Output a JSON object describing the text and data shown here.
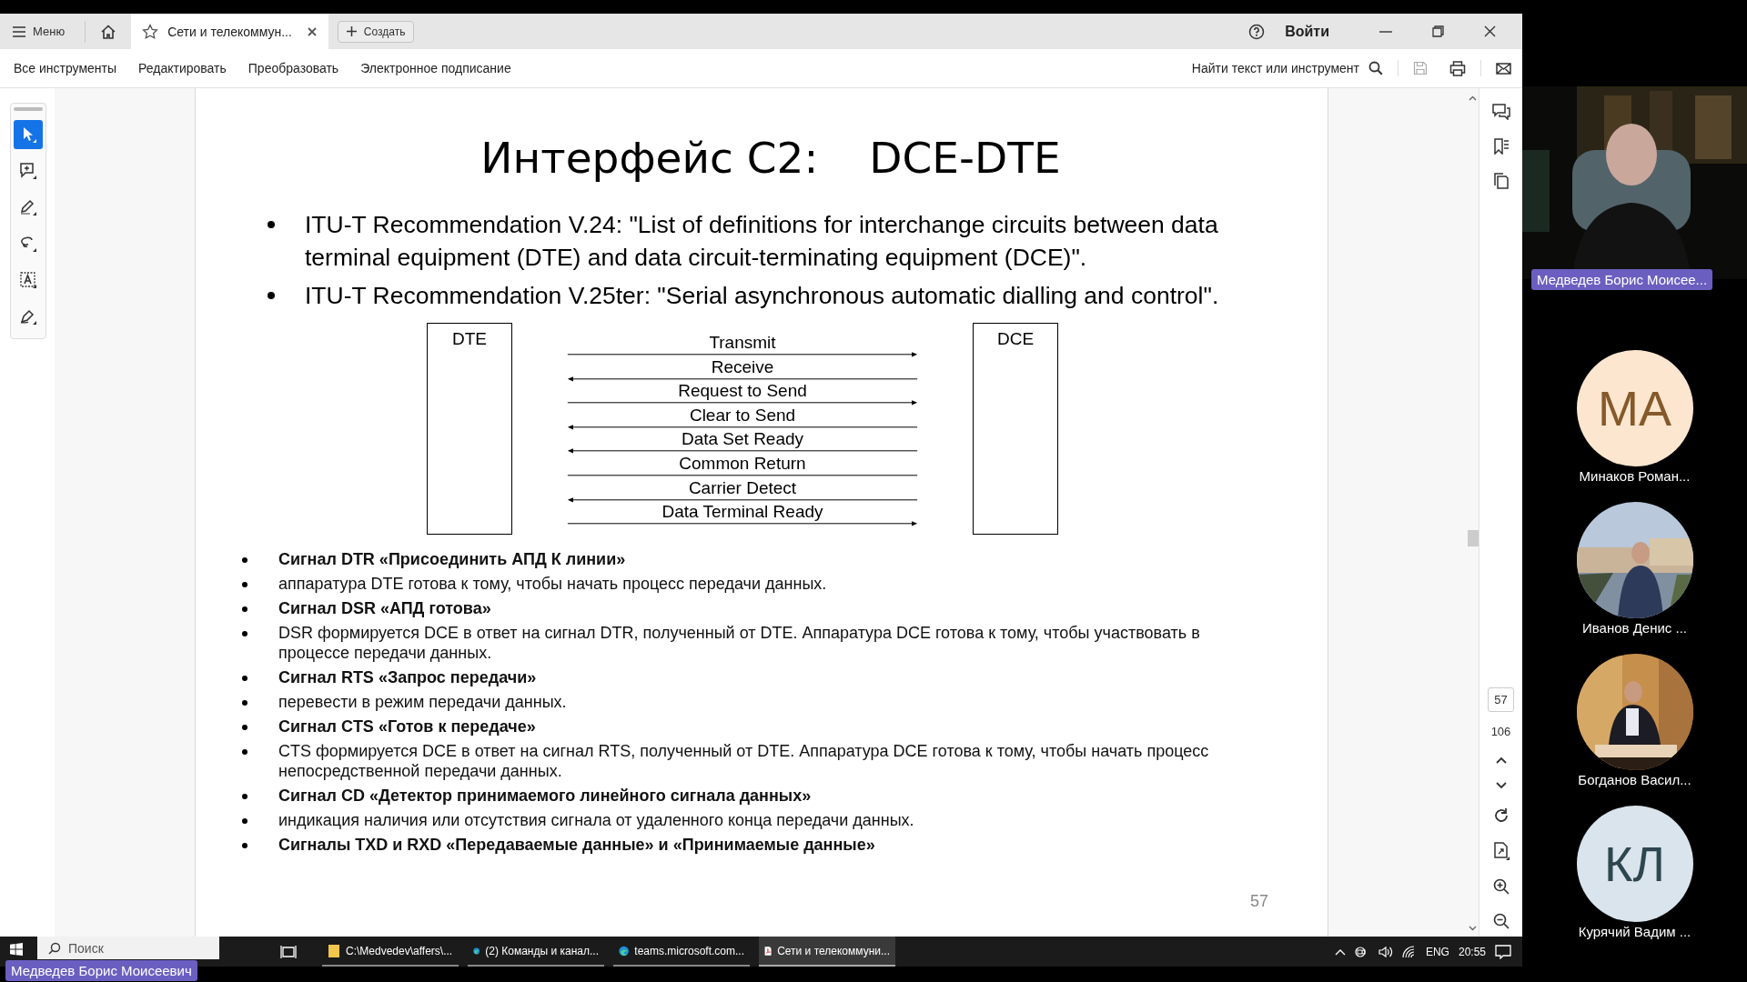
{
  "app_bar": {
    "menu": "Меню",
    "tabs": [
      {
        "title": "Сети и телекоммун...",
        "selected": true
      }
    ],
    "create": "Создать",
    "sign_in": "Войти"
  },
  "toolbar": {
    "items": [
      "Все инструменты",
      "Редактировать",
      "Преобразовать",
      "Электронное подписание"
    ],
    "search": "Найти текст или инструмент"
  },
  "tools": [
    {
      "kind": "select",
      "selected": true
    },
    {
      "kind": "comment",
      "selected": false
    },
    {
      "kind": "draw",
      "selected": false
    },
    {
      "kind": "lasso",
      "selected": false
    },
    {
      "kind": "text",
      "selected": false
    },
    {
      "kind": "sign",
      "selected": false
    }
  ],
  "slide": {
    "title": [
      "Интерфейс C2:",
      "DCE-DTE"
    ],
    "bullets": [
      "ITU-T Recommendation V.24: \"List of definitions for interchange circuits between data terminal equipment (DTE) and data circuit-terminating equipment (DCE)\".",
      "ITU-T Recommendation V.25ter: \"Serial asynchronous automatic dialling and control\"."
    ],
    "diagram": {
      "left": "DTE",
      "right": "DCE",
      "signals": [
        {
          "label": "Transmit",
          "kind": "right"
        },
        {
          "label": "Receive",
          "kind": "left"
        },
        {
          "label": "Request to Send",
          "kind": "right"
        },
        {
          "label": "Clear to Send",
          "kind": "left"
        },
        {
          "label": "Data Set Ready",
          "kind": "left"
        },
        {
          "label": "Common Return",
          "kind": "line"
        },
        {
          "label": "Carrier Detect",
          "kind": "left"
        },
        {
          "label": "Data Terminal Ready",
          "kind": "right"
        }
      ]
    },
    "notes": [
      {
        "kind": "heading",
        "text": "Сигнал DTR «Присоединить АПД К линии»"
      },
      {
        "kind": "text",
        "text": "аппаратура DTE готова к тому, чтобы начать процесс передачи данных."
      },
      {
        "kind": "heading",
        "text": "Сигнал DSR «АПД готова»"
      },
      {
        "kind": "text",
        "text": "DSR формируется DCE в ответ на сигнал DTR, полученный от DTE. Аппаратура DCE готова к тому, чтобы участвовать в процессе передачи данных."
      },
      {
        "kind": "heading",
        "text": "Сигнал RTS «Запрос передачи»"
      },
      {
        "kind": "text",
        "text": "перевести в режим передачи данных."
      },
      {
        "kind": "heading",
        "text": "Сигнал CTS «Готов к передаче»"
      },
      {
        "kind": "text",
        "text": "CTS формируется DCE в ответ на сигнал RTS, полученный от DTE. Аппаратура DCE готова к тому, чтобы начать процесс непосредственной передачи данных."
      },
      {
        "kind": "heading",
        "text": "Сигнал CD «Детектор принимаемого линейного сигнала данных»"
      },
      {
        "kind": "text",
        "text": "индикация наличия или отсутствия сигнала от удаленного конца передачи данных."
      },
      {
        "kind": "heading",
        "text": "Сигналы TXD и RXD «Передаваемые данные» и «Принимаемые данные»"
      }
    ],
    "page_number": "57"
  },
  "page_nav": {
    "current": "57",
    "total": "106"
  },
  "taskbar": {
    "search": "Поиск",
    "apps": [
      {
        "kind": "folder",
        "title": "C:\\Medvedev\\affers\\...",
        "selected": false
      },
      {
        "kind": "browser",
        "title": "(2) Команды и канал...",
        "selected": false
      },
      {
        "kind": "browser",
        "title": "teams.microsoft.com...",
        "selected": false
      },
      {
        "kind": "pdf",
        "title": "Сети и телекоммуни...",
        "selected": true
      }
    ],
    "language": "ENG",
    "time": "20:55"
  },
  "call": {
    "presenter": "Медведев Борис Моисее...",
    "participants": [
      {
        "kind": "initials",
        "initials": "МА",
        "color": "#fce6d0",
        "name": "Минаков Роман..."
      },
      {
        "kind": "picture",
        "name": "Иванов Денис ..."
      },
      {
        "kind": "picture",
        "name": "Богданов Васил..."
      },
      {
        "kind": "initials",
        "initials": "КЛ",
        "color": "#d9e4ec",
        "name": "Курячий Вадим ..."
      }
    ],
    "self_name": "Медведев Борис Моисеевич"
  }
}
